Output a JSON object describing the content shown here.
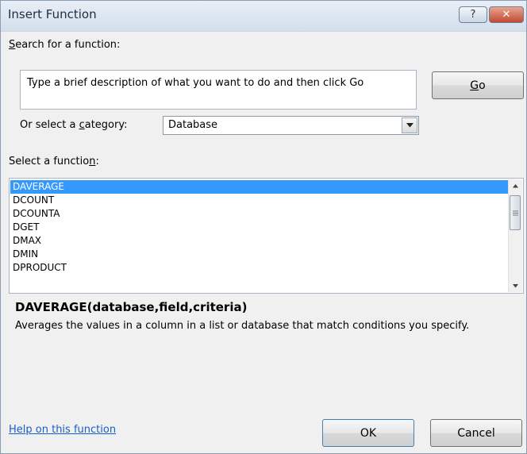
{
  "dialog": {
    "title": "Insert Function",
    "help_button": "?",
    "close_button": "✕"
  },
  "search": {
    "label_prefix": "",
    "label_accel": "S",
    "label_rest": "earch for a function:",
    "value": "Type a brief description of what you want to do and then click Go",
    "go_accel": "G",
    "go_rest": "o"
  },
  "category": {
    "label_prefix": "Or select a ",
    "label_accel": "c",
    "label_rest": "ategory:",
    "selected": "Database"
  },
  "functions": {
    "label_prefix": "Select a functio",
    "label_accel": "n",
    "label_rest": ":",
    "items": [
      "DAVERAGE",
      "DCOUNT",
      "DCOUNTA",
      "DGET",
      "DMAX",
      "DMIN",
      "DPRODUCT"
    ],
    "selected_index": 0
  },
  "details": {
    "signature": "DAVERAGE(database,field,criteria)",
    "description": "Averages the values in a column in a list or database that match conditions you specify."
  },
  "footer": {
    "help_link": "Help on this function",
    "ok_label": "OK",
    "cancel_label": "Cancel"
  },
  "icons": {
    "dropdown": "chevron-down-icon",
    "scroll_up": "scroll-up-icon",
    "scroll_down": "scroll-down-icon"
  }
}
